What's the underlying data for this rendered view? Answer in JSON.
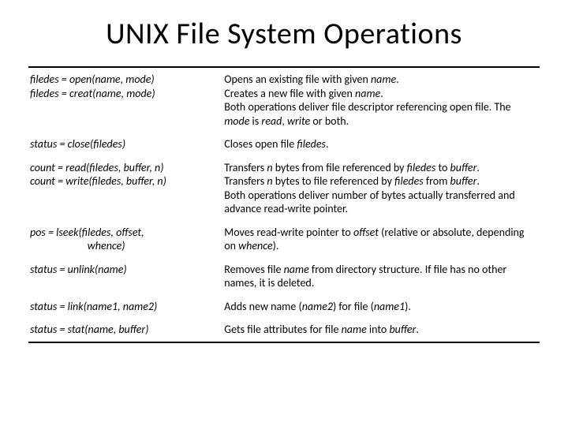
{
  "title": "UNIX File System Operations",
  "rows": [
    {
      "left": "filedes = open(name, mode)\nfiledes = creat(name, mode)",
      "right": "Opens an existing file with given <i>name</i>.\nCreates a new file with given <i>name</i>.\nBoth operations deliver file descriptor referencing open file. The <i>mode</i> is <i>read</i>, <i>write</i> or both."
    },
    {
      "left": "status = close(filedes)",
      "right": "Closes open file <i>filedes</i>."
    },
    {
      "left": "count = read(filedes, buffer, n)\ncount = write(filedes, buffer, n)",
      "right": "Transfers <i>n</i> bytes from file referenced by <i>filedes</i> to <i>buffer</i>.\nTransfers <i>n</i> bytes to file referenced by <i>filedes</i> from <i>buffer</i>.\nBoth operations deliver number of bytes actually transferred and advance read-write pointer."
    },
    {
      "left": "pos = lseek(filedes, offset,\n                       whence)",
      "right": "Moves read-write pointer to <i>offset</i> (relative or absolute, depending on <i>whence</i>)."
    },
    {
      "left": "status = unlink(name)",
      "right": "Removes file <i>name</i> from directory structure. If file has no other names, it is deleted."
    },
    {
      "left": "status = link(name1, name2)",
      "right": "Adds new name (<i>name2</i>) for file (<i>name1</i>)."
    },
    {
      "left": "status = stat(name, buffer)",
      "right": "Gets file attributes for file <i>name</i> into <i>buffer</i>."
    }
  ]
}
